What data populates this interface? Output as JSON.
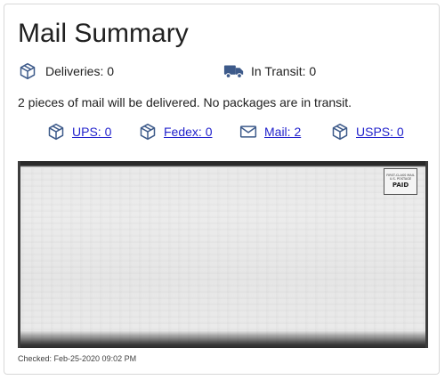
{
  "title": "Mail Summary",
  "stats": {
    "deliveries": {
      "label": "Deliveries: 0",
      "icon": "package-icon"
    },
    "in_transit": {
      "label": "In Transit: 0",
      "icon": "truck-icon"
    }
  },
  "summary": "2 pieces of mail will be delivered. No packages are in transit.",
  "carriers": [
    {
      "label": "UPS: 0",
      "icon": "package-icon"
    },
    {
      "label": "Fedex: 0",
      "icon": "package-icon"
    },
    {
      "label": "Mail: 2",
      "icon": "envelope-icon"
    },
    {
      "label": "USPS: 0",
      "icon": "package-icon"
    }
  ],
  "mail_image": {
    "stamp_line1": "FIRST-CLASS MAIL",
    "stamp_line2": "U.S. POSTAGE",
    "stamp_line3": "PAID"
  },
  "checked": "Checked: Feb-25-2020 09:02 PM",
  "colors": {
    "icon": "#3d5a8a",
    "link": "#2222cc",
    "text": "#212121"
  }
}
